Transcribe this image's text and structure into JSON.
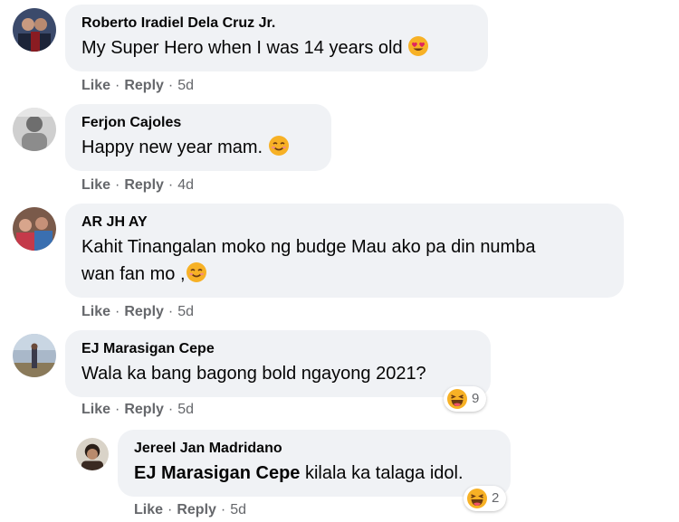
{
  "comments": [
    {
      "author": "Roberto Iradiel Dela Cruz Jr.",
      "text": "My Super Hero when I was 14 years old",
      "emoji": "heart-eyes-emoji",
      "like": "Like",
      "reply": "Reply",
      "time": "5d",
      "sep": "·"
    },
    {
      "author": "Ferjon Cajoles",
      "text": "Happy new year mam.",
      "emoji": "smiling-emoji",
      "like": "Like",
      "reply": "Reply",
      "time": "4d",
      "sep": "·"
    },
    {
      "author": "AR JH AY",
      "text_line1": "Kahit Tinangalan moko ng budge Mau ako pa din numba",
      "text_line2": "wan fan mo ,",
      "emoji": "smiling-emoji",
      "like": "Like",
      "reply": "Reply",
      "time": "5d",
      "sep": "·"
    },
    {
      "author": "EJ Marasigan Cepe",
      "text": "Wala ka bang bagong bold ngayong 2021?",
      "reaction": {
        "icon": "haha-reaction-icon",
        "count": "9"
      },
      "like": "Like",
      "reply": "Reply",
      "time": "5d",
      "sep": "·"
    },
    {
      "author": "Jereel Jan Madridano",
      "mention": "EJ Marasigan Cepe",
      "text": " kilala ka talaga idol.",
      "reaction": {
        "icon": "haha-reaction-icon",
        "count": "2"
      },
      "like": "Like",
      "reply": "Reply",
      "time": "5d",
      "sep": "·"
    }
  ],
  "colors": {
    "bubble": "#f0f2f5",
    "meta": "#65676b",
    "text": "#050505",
    "emoji_yellow": "#f7b125"
  }
}
